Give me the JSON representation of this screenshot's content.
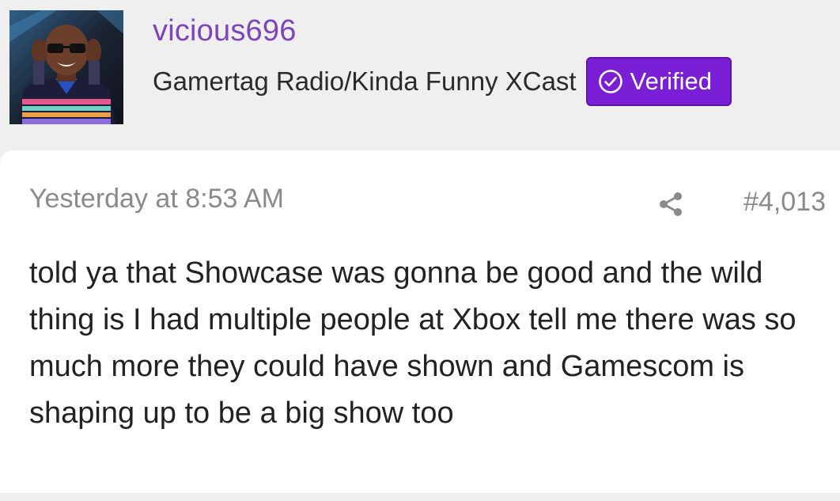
{
  "user": {
    "username": "vicious696",
    "title": "Gamertag Radio/Kinda Funny XCast",
    "badge_label": "Verified"
  },
  "post": {
    "timestamp": "Yesterday at 8:53 AM",
    "number": "#4,013",
    "body": "told ya that Showcase was gonna be good and the wild thing is I had multiple people at Xbox tell me there was so much more they could have shown and Gamescom is shaping up to be a big show too"
  },
  "icons": {
    "badge": "check-circle-icon",
    "share": "share-icon"
  },
  "colors": {
    "username": "#7d45b8",
    "badge_bg": "#7b1fd6",
    "page_bg": "#efeff0",
    "card_bg": "#ffffff",
    "meta_text": "#8a8a8a",
    "body_text": "#222222"
  }
}
